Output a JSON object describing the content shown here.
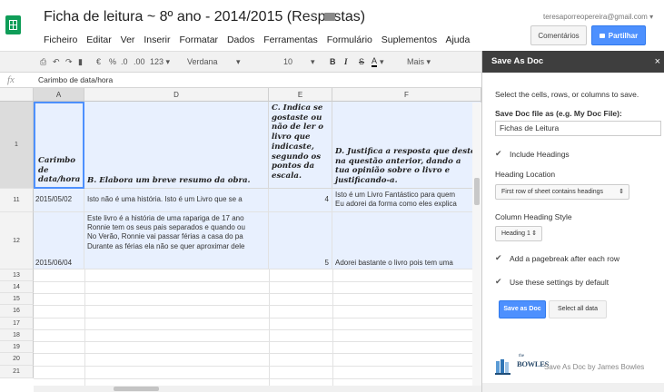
{
  "document": {
    "title": "Ficha de leitura ~ 8º ano - 2014/2015 (Respostas)",
    "menu": [
      "Ficheiro",
      "Editar",
      "Ver",
      "Inserir",
      "Formatar",
      "Dados",
      "Ferramentas",
      "Formulário",
      "Suplementos",
      "Ajuda"
    ],
    "account_email": "teresaporreopereira@gmail.com",
    "comments_label": "Comentários",
    "share_label": "Partilhar"
  },
  "toolbar": {
    "currency": "€",
    "percent": "%",
    "dec_less": ".0",
    "dec_more": ".00",
    "format_more": "123",
    "font": "Verdana",
    "font_size": "10",
    "bold": "B",
    "italic": "I",
    "strike": "S",
    "text_color": "A",
    "more": "Mais"
  },
  "formula_bar": {
    "fx": "fx",
    "value": "Carimbo de data/hora"
  },
  "grid": {
    "columns": [
      "A",
      "D",
      "E",
      "F"
    ],
    "rows": [
      "1",
      "11",
      "12",
      "13",
      "14",
      "15",
      "16",
      "17",
      "18",
      "19",
      "20",
      "21"
    ],
    "header_cells": {
      "A": "Carimbo de data/hora",
      "D": "B. Elabora um breve resumo da obra.",
      "E": "C. Indica se gostaste ou não de ler o livro que indicaste, segundo os pontos da escala.",
      "F": "D. Justifica a resposta que deste na questão anterior, dando a tua opinião sobre o livro e justificando-a."
    },
    "row11": {
      "A": "2015/05/02",
      "D": "Isto não é uma história. Isto é um Livro que se a",
      "E": "4",
      "F1": "Isto é um Livro Fantástico para quem",
      "F2": "Eu adorei da forma como eles explica"
    },
    "row12": {
      "A": "2015/06/04",
      "D1": "Este livro é a história de uma rapariga de 17 ano",
      "D2": "Ronnie tem os seus pais separados e quando ou",
      "D3": "No Verão, Ronnie vai passar férias a casa do pa",
      "D4": "Durante as férias ela não se quer aproximar dele",
      "E": "5",
      "F": "Adorei bastante o livro pois tem uma"
    }
  },
  "sidepanel": {
    "title": "Save As Doc",
    "close": "×",
    "instructions": "Select the cells, rows, or columns to save.",
    "filename_label": "Save Doc file as (e.g. My Doc File):",
    "filename_value": "Fichas de Leitura",
    "include_headings": "Include Headings",
    "heading_location_label": "Heading Location",
    "heading_location_value": "First row of sheet contains headings",
    "column_heading_style_label": "Column Heading Style",
    "column_heading_style_value": "Heading 1",
    "pagebreak_label": "Add a pagebreak after each row",
    "default_settings_label": "Use these settings by default",
    "save_button": "Save as Doc",
    "select_all_button": "Select all data",
    "brand_small": "the",
    "brand": "BOWLES",
    "caption": "Save As Doc by James Bowles"
  },
  "colors": {
    "share_blue": "#4d90fe",
    "sheets_green": "#0f9d58",
    "panel_header": "#3e3e3e",
    "selection": "#e8f0fe"
  }
}
